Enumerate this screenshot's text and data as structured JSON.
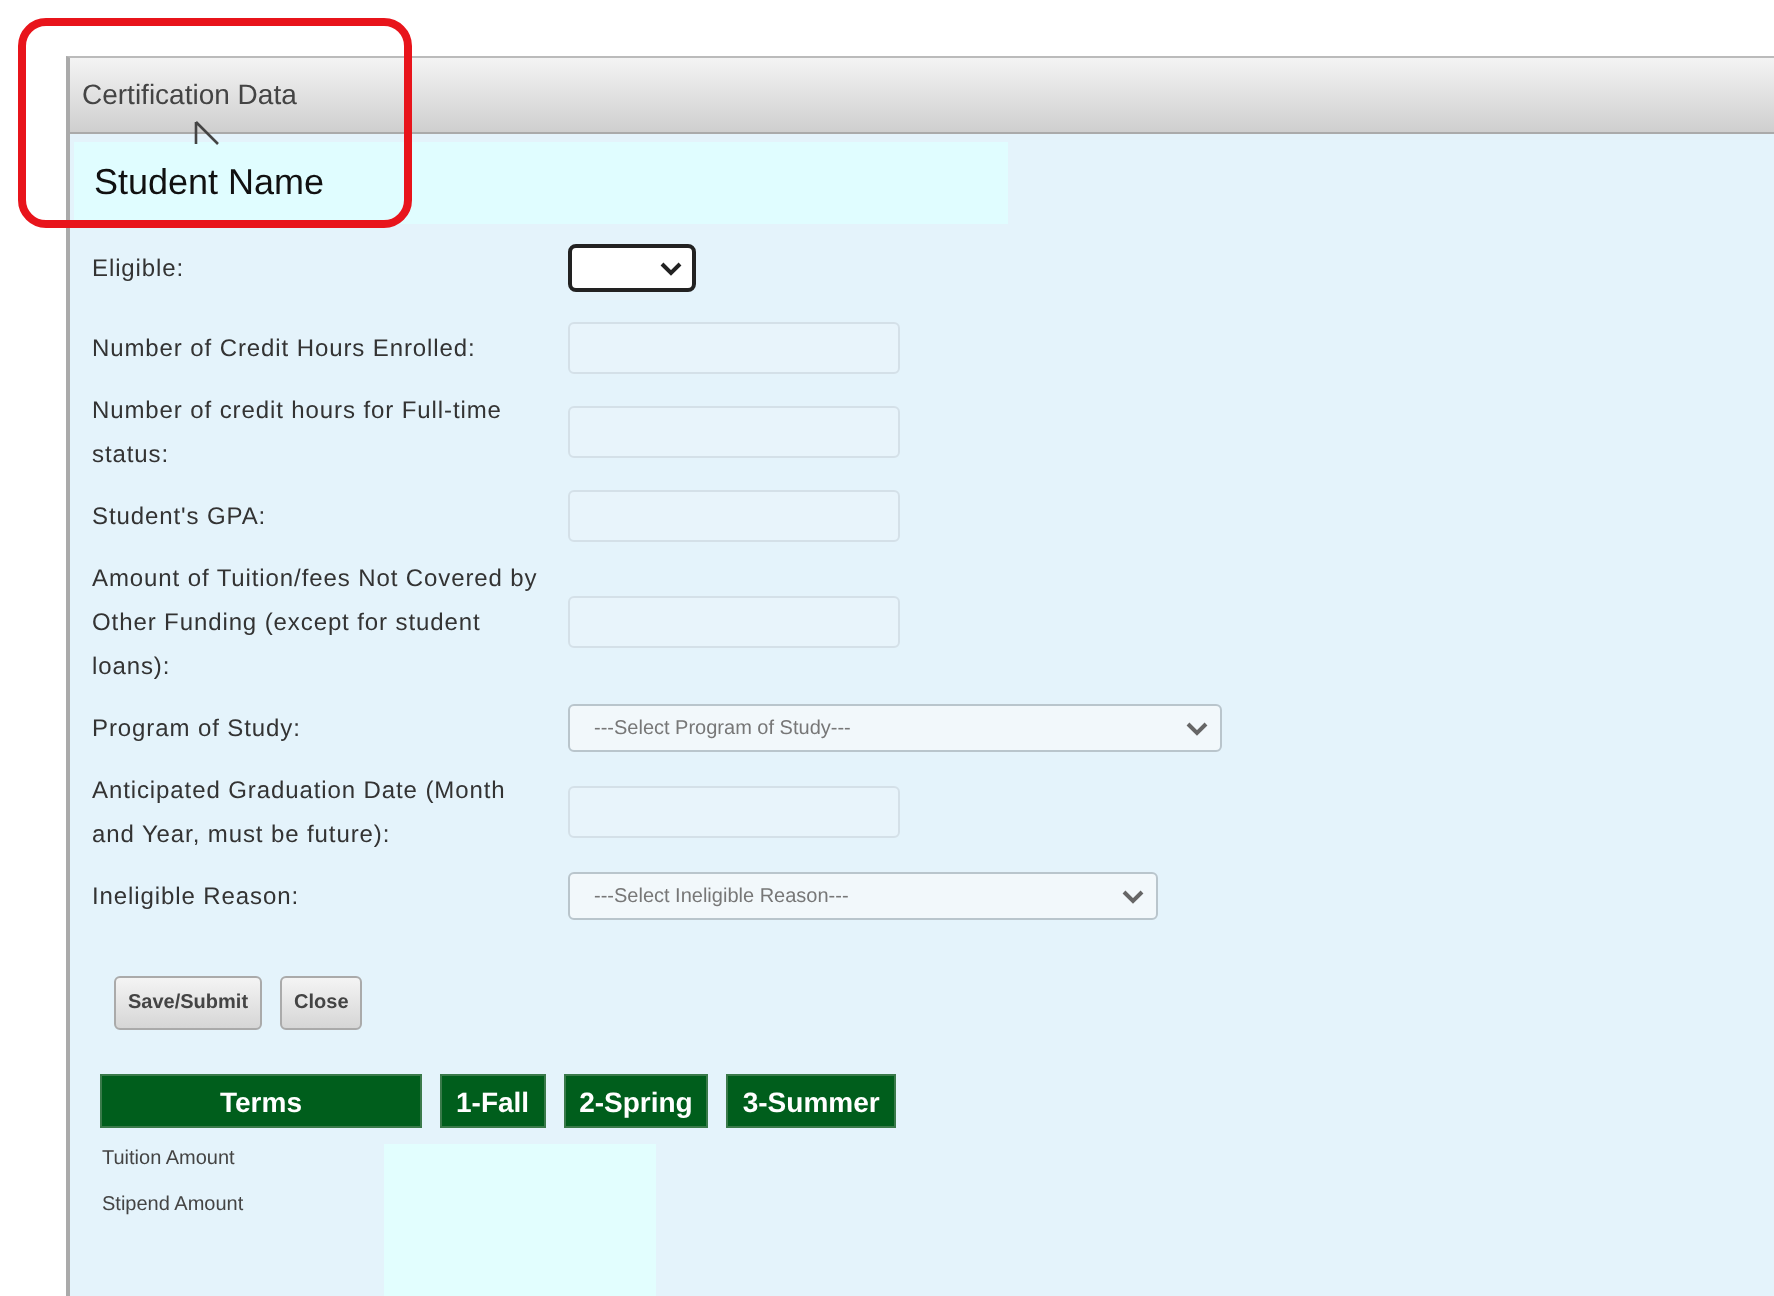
{
  "panel": {
    "title": "Certification Data"
  },
  "student_name": "Student Name",
  "fields": [
    {
      "label": "Eligible:",
      "kind": "dropdown",
      "focused": true
    },
    {
      "label": "Number of Credit Hours Enrolled:",
      "kind": "text"
    },
    {
      "label": "Number of credit hours for Full-time status:",
      "kind": "text"
    },
    {
      "label": "Student's GPA:",
      "kind": "text"
    },
    {
      "label": "Amount of Tuition/fees Not Covered by Other Funding (except for student loans):",
      "kind": "text"
    },
    {
      "label": "Program of Study:",
      "kind": "select",
      "wide": true,
      "value": "---Select Program of Study---",
      "focused": false
    },
    {
      "label": "Anticipated Graduation Date (Month and Year, must be future):",
      "kind": "text"
    },
    {
      "label": "Ineligible Reason:",
      "kind": "select",
      "wide": false,
      "value": "---Select Ineligible Reason---",
      "focused": false
    }
  ],
  "buttons": [
    "Save/Submit",
    "Close"
  ],
  "terms": {
    "columns": [
      "Terms",
      "1-Fall",
      "2-Spring",
      "3-Summer"
    ],
    "rows": [
      "Tuition Amount",
      "Stipend Amount"
    ]
  }
}
